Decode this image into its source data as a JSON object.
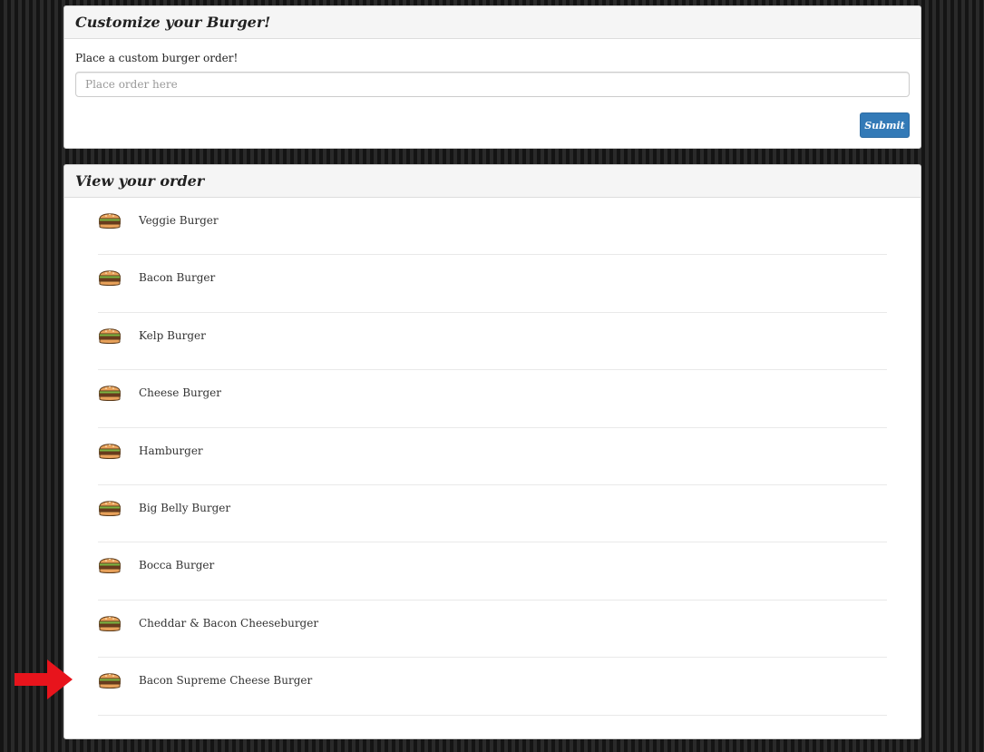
{
  "customize": {
    "title": "Customize your Burger!",
    "prompt": "Place a custom burger order!",
    "input_value": "",
    "input_placeholder": "Place order here",
    "submit_label": "Submit"
  },
  "order": {
    "title": "View your order",
    "items": [
      {
        "label": "Veggie Burger",
        "icon": "burger-icon"
      },
      {
        "label": "Bacon Burger",
        "icon": "burger-icon"
      },
      {
        "label": "Kelp Burger",
        "icon": "burger-icon"
      },
      {
        "label": "Cheese Burger",
        "icon": "burger-icon"
      },
      {
        "label": "Hamburger",
        "icon": "burger-icon"
      },
      {
        "label": "Big Belly Burger",
        "icon": "burger-icon"
      },
      {
        "label": "Bocca Burger",
        "icon": "burger-icon"
      },
      {
        "label": "Cheddar & Bacon Cheeseburger",
        "icon": "burger-icon"
      },
      {
        "label": "Bacon Supreme Cheese Burger",
        "icon": "burger-icon"
      }
    ]
  },
  "annotation": {
    "arrow_icon": "right-arrow-icon",
    "arrow_color": "#e8141c"
  },
  "colors": {
    "button": "#337ab7",
    "panel_heading": "#f5f5f5"
  }
}
